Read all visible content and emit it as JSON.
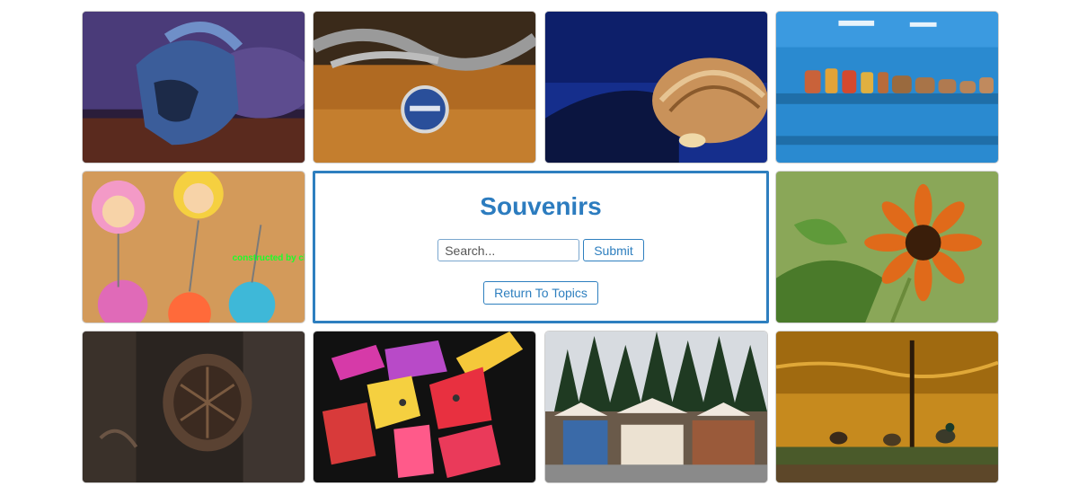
{
  "page": {
    "title": "Souvenirs",
    "search": {
      "placeholder": "Search...",
      "value": ""
    },
    "submit_label": "Submit",
    "return_label": "Return To Topics"
  },
  "tiles": [
    {
      "name": "helmet-photo"
    },
    {
      "name": "charm-bracelet-photo"
    },
    {
      "name": "seashell-photo"
    },
    {
      "name": "figurines-shelf-photo"
    },
    {
      "name": "doll-keychains-photo",
      "text": "constructed by claybables"
    },
    {
      "name": "sunflower-photo"
    },
    {
      "name": "carved-wood-photo"
    },
    {
      "name": "painted-fish-photo"
    },
    {
      "name": "market-stalls-photo"
    },
    {
      "name": "pond-ducks-photo"
    }
  ],
  "colors": {
    "accent": "#2e7fbf",
    "title": "#2c7cbf"
  }
}
